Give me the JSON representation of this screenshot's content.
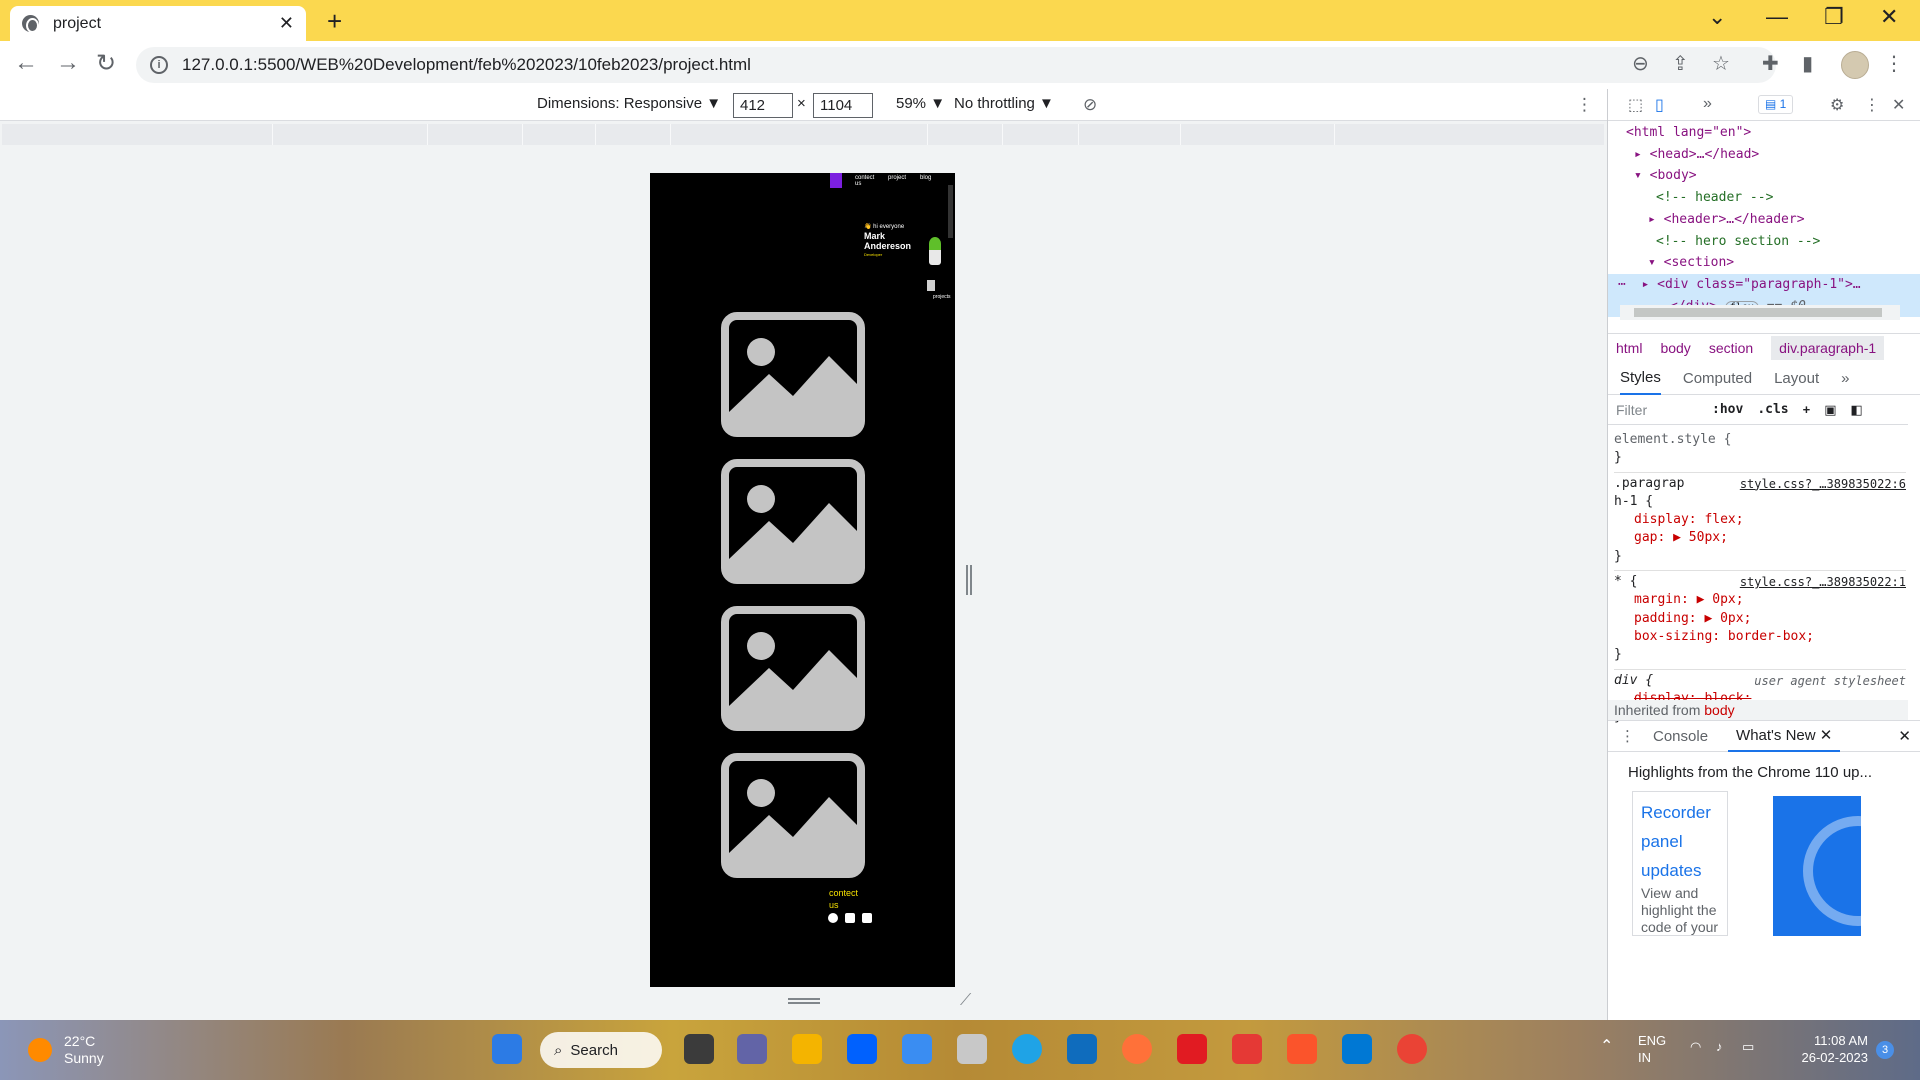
{
  "browser": {
    "tab_title": "project",
    "tab_close": "✕",
    "new_tab": "+",
    "url": "127.0.0.1:5500/WEB%20Development/feb%202023/10feb2023/project.html",
    "accent": "#fbd84f"
  },
  "device_toolbar": {
    "dimensions_label": "Dimensions: Responsive ▼",
    "width": "412",
    "times": "×",
    "height": "1104",
    "zoom": "59% ▼",
    "throttling": "No throttling ▼"
  },
  "site": {
    "nav": [
      "contect us",
      "project",
      "blog"
    ],
    "greeting_emoji": "👋",
    "greeting": "hi everyone",
    "name": "Mark Andereson",
    "role": "Developer",
    "projects_label": "projects",
    "contact": "contect us",
    "accent": "#f6e000",
    "logo_color": "#7c1fe0"
  },
  "devtools": {
    "messages_badge": "1",
    "dom_lines": [
      {
        "text": "<html lang=\"en\">"
      },
      {
        "text": "<head>…</head>"
      },
      {
        "text": "<body>"
      },
      {
        "text": "<!-- header -->"
      },
      {
        "text": "<header>…</header>"
      },
      {
        "text": "<!-- hero section -->"
      },
      {
        "text": "<section>"
      },
      {
        "text": "<div class=\"paragraph-1\">…"
      },
      {
        "text": "</div>"
      }
    ],
    "dom_flex_pill": "flex",
    "dom_eq": "== $0",
    "breadcrumbs": [
      "html",
      "body",
      "section",
      "div.paragraph-1"
    ],
    "style_tabs": [
      "Styles",
      "Computed",
      "Layout",
      "»"
    ],
    "filter_placeholder": "Filter",
    "hov": ":hov",
    "cls": ".cls",
    "rules": {
      "element_style": "element.style {",
      "close": "}",
      "r1_sel": ".paragrap h-1 {",
      "r1_src": "style.css?_…389835022:6",
      "r1_p1": "display: flex;",
      "r1_p2": "gap: ▶ 50px;",
      "r2_sel": "* {",
      "r2_src": "style.css?_…389835022:1",
      "r2_p1": "margin: ▶ 0px;",
      "r2_p2": "padding: ▶ 0px;",
      "r2_p3": "box-sizing: border-box;",
      "r3_sel": "div {",
      "r3_src": "user agent stylesheet",
      "r3_p1": "display: block;"
    },
    "inherited_prefix": "Inherited from",
    "inherited_from": "body",
    "drawer_tabs": [
      "Console",
      "What's New"
    ],
    "whats_new_heading": "Highlights from the Chrome 110 up...",
    "card_title": "Recorder panel updates",
    "card_desc": "View and highlight the code of your"
  },
  "taskbar": {
    "temp": "22°C",
    "condition": "Sunny",
    "search": "Search",
    "lang1": "ENG",
    "lang2": "IN",
    "time": "11:08 AM",
    "date": "26-02-2023",
    "notifications": "3"
  }
}
